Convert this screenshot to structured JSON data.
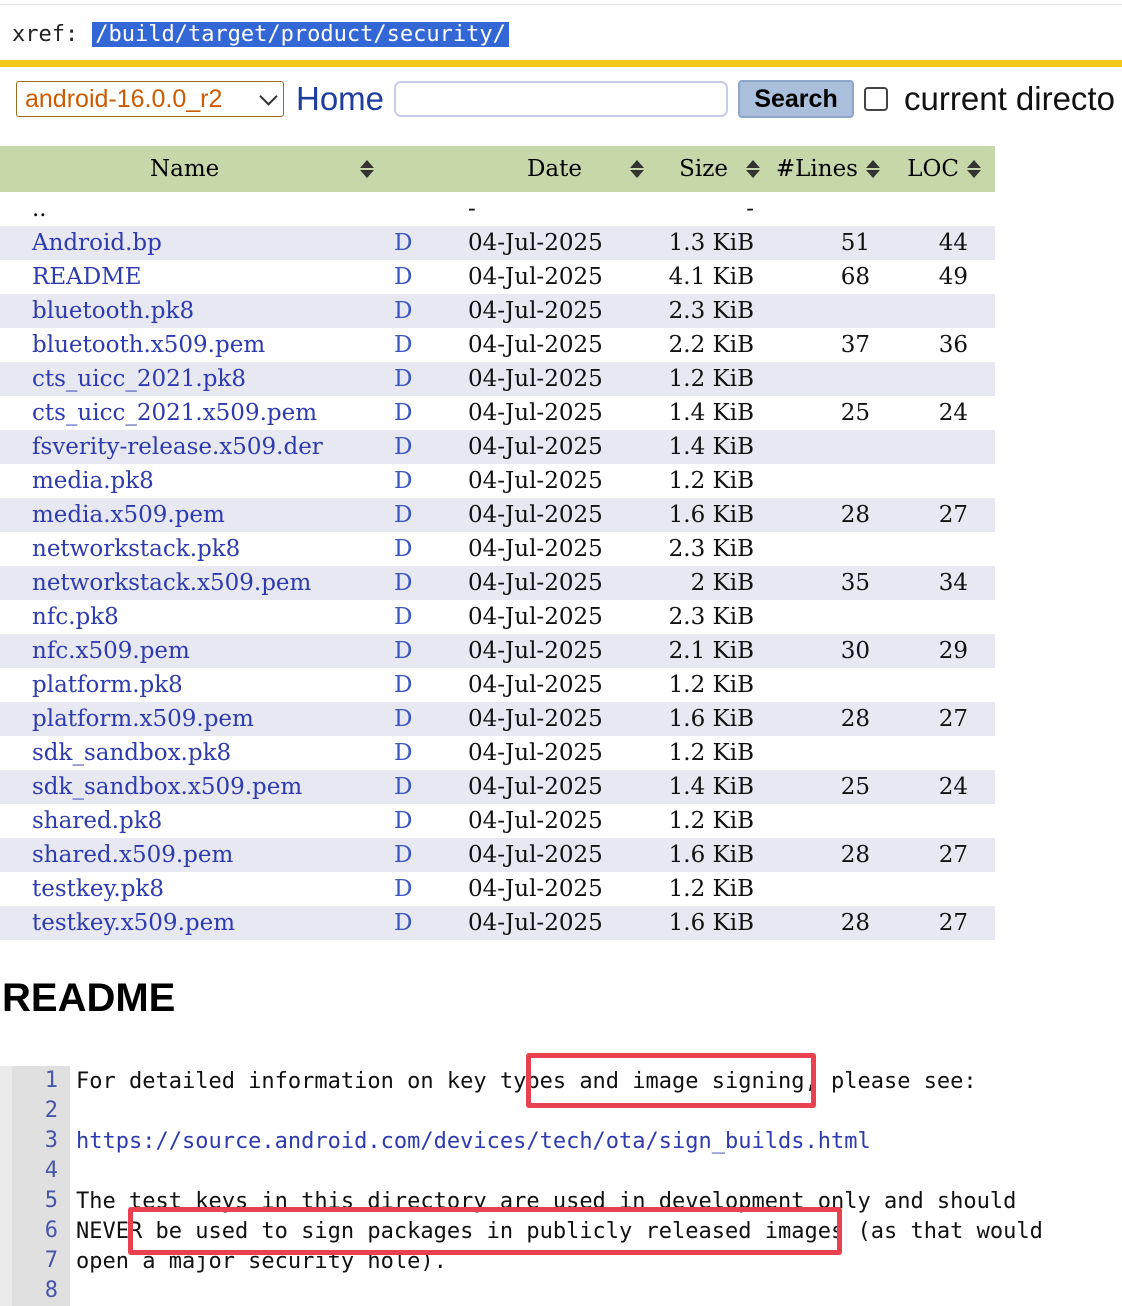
{
  "header": {
    "xref_label": "xref:",
    "path": "/build/target/product/security/"
  },
  "toolbar": {
    "branch_selected": "android-16.0.0_r2",
    "home_label": "Home",
    "search_value": "",
    "search_button": "Search",
    "current_dir_label": "current directo"
  },
  "table": {
    "headers": {
      "name": "Name",
      "date": "Date",
      "size": "Size",
      "lines": "#Lines",
      "loc": "LOC"
    },
    "parent": {
      "name": "..",
      "date": "-",
      "size": "-"
    },
    "rows": [
      {
        "name": "Android.bp",
        "d": "D",
        "date": "04-Jul-2025",
        "size": "1.3 KiB",
        "lines": "51",
        "loc": "44"
      },
      {
        "name": "README",
        "d": "D",
        "date": "04-Jul-2025",
        "size": "4.1 KiB",
        "lines": "68",
        "loc": "49"
      },
      {
        "name": "bluetooth.pk8",
        "d": "D",
        "date": "04-Jul-2025",
        "size": "2.3 KiB",
        "lines": "",
        "loc": ""
      },
      {
        "name": "bluetooth.x509.pem",
        "d": "D",
        "date": "04-Jul-2025",
        "size": "2.2 KiB",
        "lines": "37",
        "loc": "36"
      },
      {
        "name": "cts_uicc_2021.pk8",
        "d": "D",
        "date": "04-Jul-2025",
        "size": "1.2 KiB",
        "lines": "",
        "loc": ""
      },
      {
        "name": "cts_uicc_2021.x509.pem",
        "d": "D",
        "date": "04-Jul-2025",
        "size": "1.4 KiB",
        "lines": "25",
        "loc": "24"
      },
      {
        "name": "fsverity-release.x509.der",
        "d": "D",
        "date": "04-Jul-2025",
        "size": "1.4 KiB",
        "lines": "",
        "loc": ""
      },
      {
        "name": "media.pk8",
        "d": "D",
        "date": "04-Jul-2025",
        "size": "1.2 KiB",
        "lines": "",
        "loc": ""
      },
      {
        "name": "media.x509.pem",
        "d": "D",
        "date": "04-Jul-2025",
        "size": "1.6 KiB",
        "lines": "28",
        "loc": "27"
      },
      {
        "name": "networkstack.pk8",
        "d": "D",
        "date": "04-Jul-2025",
        "size": "2.3 KiB",
        "lines": "",
        "loc": ""
      },
      {
        "name": "networkstack.x509.pem",
        "d": "D",
        "date": "04-Jul-2025",
        "size": "2 KiB",
        "lines": "35",
        "loc": "34"
      },
      {
        "name": "nfc.pk8",
        "d": "D",
        "date": "04-Jul-2025",
        "size": "2.3 KiB",
        "lines": "",
        "loc": ""
      },
      {
        "name": "nfc.x509.pem",
        "d": "D",
        "date": "04-Jul-2025",
        "size": "2.1 KiB",
        "lines": "30",
        "loc": "29"
      },
      {
        "name": "platform.pk8",
        "d": "D",
        "date": "04-Jul-2025",
        "size": "1.2 KiB",
        "lines": "",
        "loc": ""
      },
      {
        "name": "platform.x509.pem",
        "d": "D",
        "date": "04-Jul-2025",
        "size": "1.6 KiB",
        "lines": "28",
        "loc": "27"
      },
      {
        "name": "sdk_sandbox.pk8",
        "d": "D",
        "date": "04-Jul-2025",
        "size": "1.2 KiB",
        "lines": "",
        "loc": ""
      },
      {
        "name": "sdk_sandbox.x509.pem",
        "d": "D",
        "date": "04-Jul-2025",
        "size": "1.4 KiB",
        "lines": "25",
        "loc": "24"
      },
      {
        "name": "shared.pk8",
        "d": "D",
        "date": "04-Jul-2025",
        "size": "1.2 KiB",
        "lines": "",
        "loc": ""
      },
      {
        "name": "shared.x509.pem",
        "d": "D",
        "date": "04-Jul-2025",
        "size": "1.6 KiB",
        "lines": "28",
        "loc": "27"
      },
      {
        "name": "testkey.pk8",
        "d": "D",
        "date": "04-Jul-2025",
        "size": "1.2 KiB",
        "lines": "",
        "loc": ""
      },
      {
        "name": "testkey.x509.pem",
        "d": "D",
        "date": "04-Jul-2025",
        "size": "1.6 KiB",
        "lines": "28",
        "loc": "27"
      }
    ]
  },
  "readme": {
    "heading": "README",
    "lines": [
      {
        "n": "1",
        "text": "For detailed information on key types and image signing, please see:"
      },
      {
        "n": "2",
        "text": ""
      },
      {
        "n": "3",
        "text": "https://source.android.com/devices/tech/ota/sign_builds.html",
        "link": true
      },
      {
        "n": "4",
        "text": ""
      },
      {
        "n": "5",
        "text": "The test keys in this directory are used in development only and should"
      },
      {
        "n": "6",
        "text": "NEVER be used to sign packages in publicly released images (as that would"
      },
      {
        "n": "7",
        "text": "open a major security hole)."
      },
      {
        "n": "8",
        "text": ""
      }
    ]
  },
  "colors": {
    "header_bg": "#c6d7a9",
    "row_alt": "#e7e8f1",
    "accent_bar": "#f4c81c",
    "highlight_box": "#e9414f",
    "link": "#2e3bb0"
  }
}
